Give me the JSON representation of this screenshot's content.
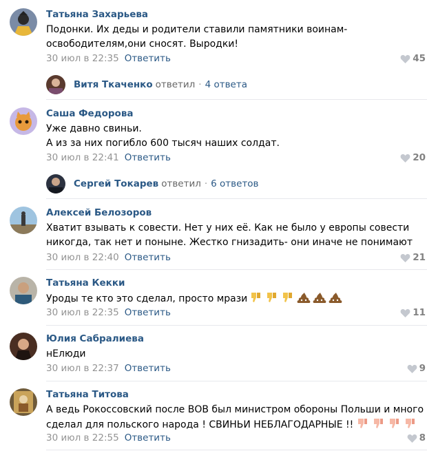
{
  "ui": {
    "reply_label": "Ответить",
    "replied_label": "ответил",
    "separator": "·"
  },
  "comments": [
    {
      "author": "Татьяна Захарьева",
      "lines": [
        "Подонки. Их деды и родители ставили памятники воинам-",
        "освободителям,они сносят. Выродки!"
      ],
      "date": "30 июл в 22:35",
      "likes": "45"
    },
    {
      "author": "Саша Федорова",
      "lines": [
        "Уже давно свиньи.",
        "А из за них погибло 600 тысяч наших солдат."
      ],
      "date": "30 июл в 22:41",
      "likes": "20"
    },
    {
      "author": "Алексей Белозоров",
      "lines": [
        "Хватит взывать к совести. Нет у них её. Как не было у европы совести",
        "никогда, так нет и поныне. Жестко гнизадить- они иначе не понимают"
      ],
      "date": "30 июл в 22:40",
      "likes": "21"
    },
    {
      "author": "Татьяна Кекки",
      "lines": [
        "Уроды те кто это сделал, просто мрази"
      ],
      "date": "30 июл в 22:35",
      "likes": "11",
      "emojis": [
        "thumbs-down-emoji",
        "thumbs-down-emoji",
        "thumbs-down-emoji",
        "poop-emoji",
        "poop-emoji",
        "poop-emoji"
      ]
    },
    {
      "author": "Юлия Сабралиева",
      "lines": [
        "нЕлюди"
      ],
      "date": "30 июл в 22:37",
      "likes": "9"
    },
    {
      "author": "Татьяна Титова",
      "lines": [
        "А ведь Рокоссовский после ВОВ был министром обороны Польши и много",
        "сделал для польского народа ! СВИНЬИ НЕБЛАГОДАРНЫЕ !!"
      ],
      "date": "30 июл в 22:55",
      "likes": "8",
      "emojis": [
        "thumbs-down-emoji",
        "thumbs-down-emoji",
        "thumbs-down-emoji",
        "thumbs-down-emoji"
      ]
    }
  ],
  "threads": [
    {
      "name": "Витя Ткаченко",
      "count": "4 ответа"
    },
    {
      "name": "Сергей Токарев",
      "count": "6 ответов"
    }
  ],
  "colors": {
    "link": "#2a5885",
    "meta": "#939393",
    "divider": "#e7e8ec",
    "likes": "#828282"
  }
}
